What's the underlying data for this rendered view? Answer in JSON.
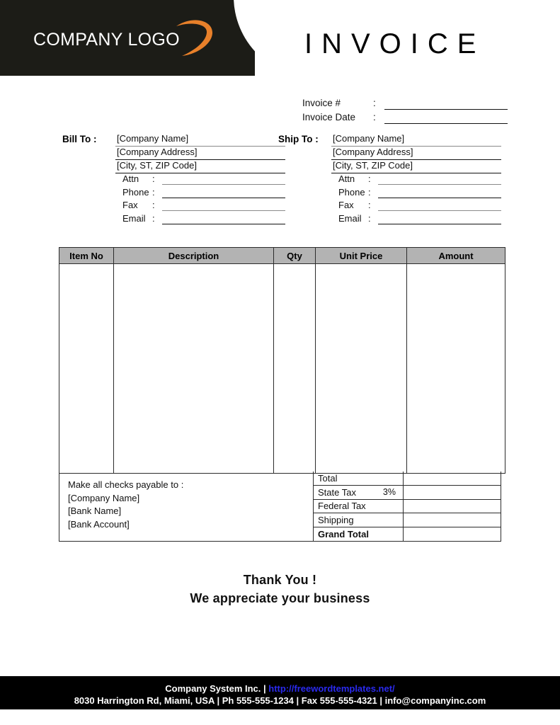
{
  "header": {
    "logo_text": "COMPANY LOGO",
    "swoosh_color": "#E8802A",
    "title": "INVOICE",
    "band_color": "#1C1C17"
  },
  "meta": {
    "rows": [
      {
        "label": "Invoice #",
        "colon": ":",
        "value": ""
      },
      {
        "label": "Invoice Date",
        "colon": ":",
        "value": ""
      }
    ]
  },
  "bill_to": {
    "title": "Bill To :",
    "address": [
      "[Company Name]",
      "[Company Address]",
      "[City, ST, ZIP Code]"
    ],
    "contacts": [
      {
        "label": "Attn",
        "colon": ":",
        "value": ""
      },
      {
        "label": "Phone",
        "colon": ":",
        "value": ""
      },
      {
        "label": "Fax",
        "colon": ":",
        "value": ""
      },
      {
        "label": "Email",
        "colon": ":",
        "value": ""
      }
    ]
  },
  "ship_to": {
    "title": "Ship To :",
    "address": [
      "[Company Name]",
      "[Company Address]",
      "[City, ST, ZIP Code]"
    ],
    "contacts": [
      {
        "label": "Attn",
        "colon": ":",
        "value": ""
      },
      {
        "label": "Phone",
        "colon": ":",
        "value": ""
      },
      {
        "label": "Fax",
        "colon": ":",
        "value": ""
      },
      {
        "label": "Email",
        "colon": ":",
        "value": ""
      }
    ]
  },
  "items_table": {
    "headers": [
      "Item No",
      "Description",
      "Qty",
      "Unit Price",
      "Amount"
    ],
    "header_bg": "#B3B3B3",
    "rows": []
  },
  "payable": {
    "lines": [
      "Make all checks payable to :",
      "[Company Name]",
      "[Bank Name]",
      "[Bank Account]"
    ]
  },
  "totals": {
    "rows": [
      {
        "label": "Total",
        "extra": "",
        "value": ""
      },
      {
        "label": "State Tax",
        "extra": "3%",
        "value": ""
      },
      {
        "label": "Federal Tax",
        "extra": "",
        "value": ""
      },
      {
        "label": "Shipping",
        "extra": "",
        "value": ""
      },
      {
        "label": "Grand Total",
        "extra": "",
        "value": ""
      }
    ]
  },
  "thanks": {
    "line1": "Thank You !",
    "line2": "We appreciate your business"
  },
  "page_footer": {
    "company": "Company System Inc. | ",
    "url": "http://freewordtemplates.net/",
    "address_line": "8030 Harrington Rd, Miami, USA | Ph 555-555-1234 | Fax 555-555-4321 | info@companyinc.com",
    "url_color": "#2A2AEE",
    "background": "#000000"
  }
}
